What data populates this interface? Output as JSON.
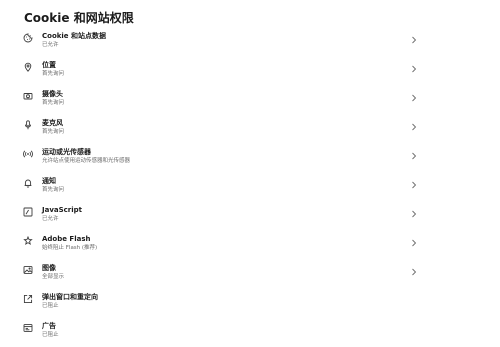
{
  "page": {
    "title": "Cookie 和网站权限"
  },
  "items": [
    {
      "label": "Cookie 和站点数据",
      "sub": "已允许",
      "icon": "cookie-icon",
      "chevron": true
    },
    {
      "label": "位置",
      "sub": "首先询问",
      "icon": "location-icon",
      "chevron": true
    },
    {
      "label": "摄像头",
      "sub": "首先询问",
      "icon": "camera-icon",
      "chevron": true
    },
    {
      "label": "麦克风",
      "sub": "首先询问",
      "icon": "microphone-icon",
      "chevron": true
    },
    {
      "label": "运动或光传感器",
      "sub": "允许站点使用运动传感器和光传感器",
      "icon": "sensor-icon",
      "chevron": true
    },
    {
      "label": "通知",
      "sub": "首先询问",
      "icon": "bell-icon",
      "chevron": true
    },
    {
      "label": "JavaScript",
      "sub": "已允许",
      "icon": "javascript-icon",
      "chevron": true
    },
    {
      "label": "Adobe Flash",
      "sub": "始终阻止 Flash (推荐)",
      "icon": "flash-icon",
      "chevron": true
    },
    {
      "label": "图像",
      "sub": "全部显示",
      "icon": "image-icon",
      "chevron": true
    },
    {
      "label": "弹出窗口和重定向",
      "sub": "已阻止",
      "icon": "popup-icon",
      "chevron": false
    },
    {
      "label": "广告",
      "sub": "已阻止",
      "icon": "ads-icon",
      "chevron": false
    }
  ],
  "colors": {
    "text": "#1b1b1b",
    "subtext": "#6b6b6b",
    "icon": "#3c3c3c",
    "chevron": "#6b6b6b"
  }
}
